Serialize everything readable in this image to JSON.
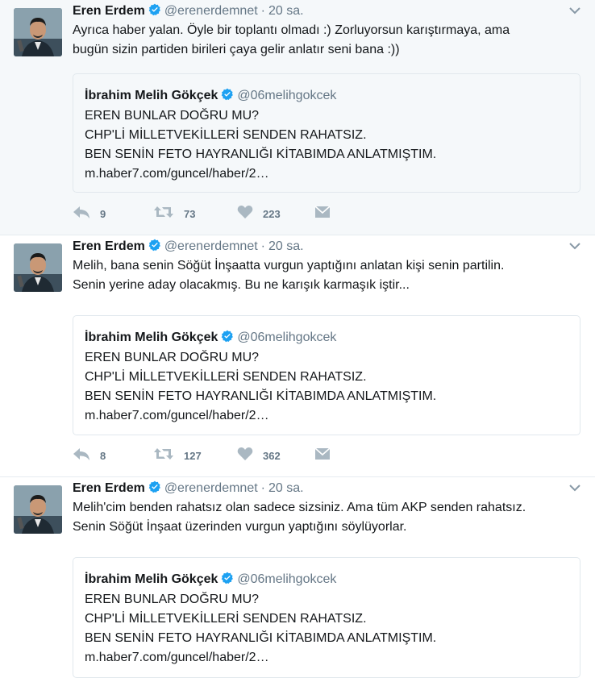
{
  "colors": {
    "text": "#14171a",
    "muted": "#657786",
    "verified": "#1da1f2",
    "border": "#e1e8ed",
    "highlight_bg": "#f5f8fa"
  },
  "tweets": [
    {
      "author": {
        "name": "Eren Erdem",
        "handle": "@erenerdemnet",
        "verified": true
      },
      "dot": "·",
      "time": "20 sa.",
      "text": "Ayrıca haber yalan. Öyle bir toplantı olmadı :) Zorluyorsun karıştırmaya, ama\nbugün sizin partiden birileri çaya gelir anlatır seni bana :))",
      "quote": {
        "name": "İbrahim Melih Gökçek",
        "handle": "@06melihgokcek",
        "lines": [
          "EREN BUNLAR DOĞRU MU?",
          "CHP'Lİ MİLLETVEKİLLERİ SENDEN RAHATSIZ.",
          "BEN SENİN FETO HAYRANLIĞI KİTABIMDA ANLATMIŞTIM.",
          "m.haber7.com/guncel/haber/2…"
        ]
      },
      "stats": {
        "replies": "9",
        "retweets": "73",
        "likes": "223"
      }
    },
    {
      "author": {
        "name": "Eren Erdem",
        "handle": "@erenerdemnet",
        "verified": true
      },
      "dot": "·",
      "time": "20 sa.",
      "text": "Melih, bana senin Söğüt İnşaatta vurgun yaptığını anlatan kişi senin partilin.\nSenin yerine aday olacakmış. Bu ne karışık karmaşık iştir...",
      "quote": {
        "name": "İbrahim Melih Gökçek",
        "handle": "@06melihgokcek",
        "lines": [
          "EREN BUNLAR DOĞRU MU?",
          "CHP'Lİ MİLLETVEKİLLERİ SENDEN RAHATSIZ.",
          "BEN SENİN FETO HAYRANLIĞI KİTABIMDA ANLATMIŞTIM.",
          "m.haber7.com/guncel/haber/2…"
        ]
      },
      "stats": {
        "replies": "8",
        "retweets": "127",
        "likes": "362"
      }
    },
    {
      "author": {
        "name": "Eren Erdem",
        "handle": "@erenerdemnet",
        "verified": true
      },
      "dot": "·",
      "time": "20 sa.",
      "text": "Melih'cim benden rahatsız olan sadece sizsiniz. Ama tüm AKP senden rahatsız.\nSenin Söğüt İnşaat üzerinden vurgun yaptığını söylüyorlar.",
      "quote": {
        "name": "İbrahim Melih Gökçek",
        "handle": "@06melihgokcek",
        "lines": [
          "EREN BUNLAR DOĞRU MU?",
          "CHP'Lİ MİLLETVEKİLLERİ SENDEN RAHATSIZ.",
          "BEN SENİN FETO HAYRANLIĞI KİTABIMDA ANLATMIŞTIM.",
          "m.haber7.com/guncel/haber/2…"
        ]
      },
      "stats": {
        "replies": "",
        "retweets": "",
        "likes": ""
      }
    }
  ]
}
